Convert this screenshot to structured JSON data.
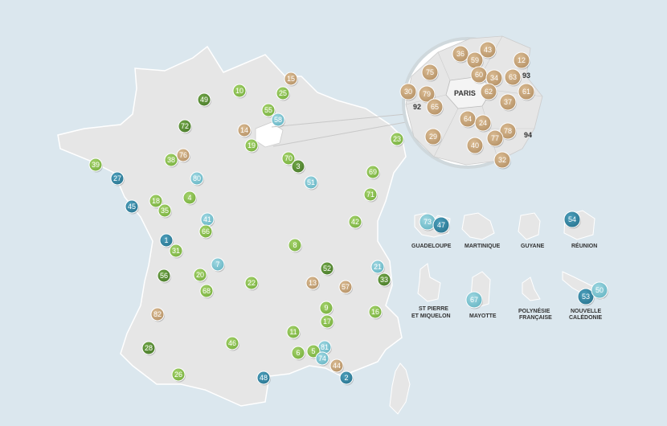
{
  "colors": {
    "background": "#dbe7ee",
    "land": "#e6e6e6",
    "land_stroke": "#ffffff",
    "green_light": "#8cc152",
    "green_dark": "#5a8f35",
    "tan": "#c9a77c",
    "teal": "#3a8aa6",
    "light_blue": "#7fc6d3"
  },
  "labels": {
    "paris": "PARIS",
    "dept_92": "92",
    "dept_93": "93",
    "dept_94": "94"
  },
  "territories": [
    {
      "id": "guadeloupe",
      "name_lines": [
        "GUADELOUPE"
      ]
    },
    {
      "id": "martinique",
      "name_lines": [
        "MARTINIQUE"
      ]
    },
    {
      "id": "guyane",
      "name_lines": [
        "GUYANE"
      ]
    },
    {
      "id": "reunion",
      "name_lines": [
        "RÉUNION"
      ]
    },
    {
      "id": "stpierre",
      "name_lines": [
        "ST PIERRE",
        "ET MIQUELON"
      ]
    },
    {
      "id": "mayotte",
      "name_lines": [
        "MAYOTTE"
      ]
    },
    {
      "id": "polynesie",
      "name_lines": [
        "POLYNÉSIE",
        "FRANÇAISE"
      ]
    },
    {
      "id": "caledonie",
      "name_lines": [
        "NOUVELLE",
        "CALÉDONIE"
      ]
    }
  ],
  "markers": {
    "m10": "10",
    "m15": "15",
    "m49": "49",
    "m25": "25",
    "m55": "55",
    "m58": "58",
    "m72": "72",
    "m14": "14",
    "m19": "19",
    "m23": "23",
    "m76": "76",
    "m38": "38",
    "m39": "39",
    "m70": "70",
    "m3": "3",
    "m69": "69",
    "m27": "27",
    "m80": "80",
    "m51": "51",
    "m18": "18",
    "m4": "4",
    "m71": "71",
    "m35": "35",
    "m45": "45",
    "m41": "41",
    "m66": "66",
    "m42": "42",
    "m1": "1",
    "m31": "31",
    "m8": "8",
    "m7": "7",
    "m52": "52",
    "m21": "21",
    "m56": "56",
    "m20": "20",
    "m22": "22",
    "m13": "13",
    "m57": "57",
    "m33": "33",
    "m68": "68",
    "m82": "82",
    "m9": "9",
    "m17": "17",
    "m16": "16",
    "m11": "11",
    "m46": "46",
    "m28": "28",
    "m81": "81",
    "m6": "6",
    "m5": "5",
    "m74": "74",
    "m44": "44",
    "m26": "26",
    "m48": "48",
    "m2": "2",
    "p36": "36",
    "p43": "43",
    "p59": "59",
    "p12": "12",
    "p75": "75",
    "p60": "60",
    "p34": "34",
    "p63": "63",
    "p30": "30",
    "p79": "79",
    "p62": "62",
    "p61": "61",
    "p65": "65",
    "p37": "37",
    "p64": "64",
    "p24": "24",
    "p78": "78",
    "p29": "29",
    "p77": "77",
    "p40": "40",
    "p32": "32",
    "t73": "73",
    "t47": "47",
    "t54": "54",
    "t67": "67",
    "t53": "53",
    "t50": "50"
  }
}
